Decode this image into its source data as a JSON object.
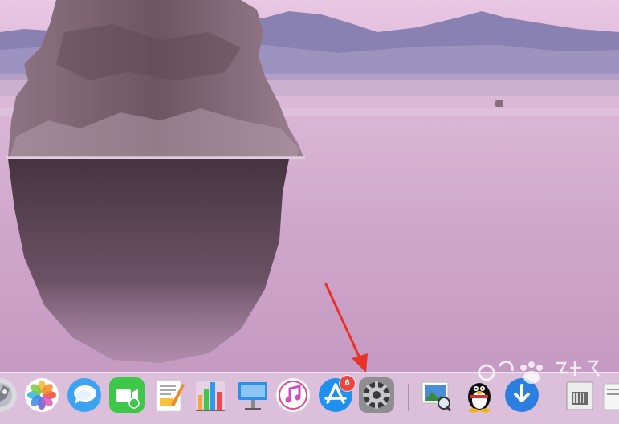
{
  "desktop": {
    "wallpaper": "mono-lake-tufa"
  },
  "dock": {
    "apps": [
      {
        "name": "launchpad",
        "icon": "rocket-icon"
      },
      {
        "name": "photos",
        "icon": "photos-flower-icon"
      },
      {
        "name": "messages",
        "icon": "speech-bubble-icon"
      },
      {
        "name": "facetime",
        "icon": "video-camera-icon"
      },
      {
        "name": "pages",
        "icon": "pen-document-icon"
      },
      {
        "name": "numbers",
        "icon": "bar-chart-icon"
      },
      {
        "name": "keynote",
        "icon": "podium-icon"
      },
      {
        "name": "itunes",
        "icon": "music-note-icon"
      },
      {
        "name": "app-store",
        "icon": "app-store-a-icon",
        "badge": "6"
      },
      {
        "name": "system-preferences",
        "icon": "gear-icon"
      },
      {
        "name": "preview",
        "icon": "photo-magnifier-icon"
      },
      {
        "name": "qq",
        "icon": "penguin-icon"
      },
      {
        "name": "downloads",
        "icon": "download-arrow-icon"
      },
      {
        "name": "archive-utility",
        "icon": "archive-icon"
      }
    ]
  },
  "annotation": {
    "arrow_color": "#e8332a",
    "points_to": "system-preferences"
  },
  "colors": {
    "sky": "#e7c3df",
    "water": "#d6b2d2",
    "mountains": "#8b82b4",
    "rock": "#6f5661",
    "badge": "#f2443a"
  }
}
